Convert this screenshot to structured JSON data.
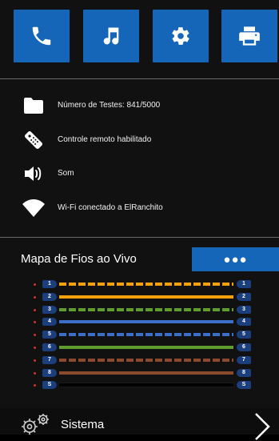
{
  "toolbar": {
    "buttons": [
      {
        "icon": "phone-icon",
        "label": "Telefone"
      },
      {
        "icon": "music-note-icon",
        "label": "Música"
      },
      {
        "icon": "gear-icon",
        "label": "Configurações"
      },
      {
        "icon": "printer-icon",
        "label": "Imprimir"
      }
    ],
    "button_color": "#1565b8"
  },
  "status": {
    "items": [
      {
        "icon": "folder-icon",
        "text": "Número de Testes: 841/5000"
      },
      {
        "icon": "remote-control-icon",
        "text": "Controle remoto habilitado"
      },
      {
        "icon": "speaker-icon",
        "text": "Som"
      },
      {
        "icon": "wifi-icon",
        "text": "Wi-Fi conectado a ElRanchito"
      }
    ]
  },
  "wire_map": {
    "title": "Mapa de Fios ao Vivo",
    "menu_button_label": "●●●",
    "wires": [
      {
        "left_pin": "1",
        "right_pin": "1",
        "color": "#f5a10a",
        "pattern": "striped"
      },
      {
        "left_pin": "2",
        "right_pin": "2",
        "color": "#f5a10a",
        "pattern": "solid"
      },
      {
        "left_pin": "3",
        "right_pin": "3",
        "color": "#5f9e2e",
        "pattern": "striped"
      },
      {
        "left_pin": "4",
        "right_pin": "4",
        "color": "#3b6fc9",
        "pattern": "solid"
      },
      {
        "left_pin": "5",
        "right_pin": "5",
        "color": "#3b6fc9",
        "pattern": "striped"
      },
      {
        "left_pin": "6",
        "right_pin": "6",
        "color": "#5f9e2e",
        "pattern": "solid"
      },
      {
        "left_pin": "7",
        "right_pin": "7",
        "color": "#8a4a2b",
        "pattern": "striped"
      },
      {
        "left_pin": "8",
        "right_pin": "8",
        "color": "#8a4a2b",
        "pattern": "solid"
      },
      {
        "left_pin": "S",
        "right_pin": "S",
        "color": "#000000",
        "pattern": "solid"
      }
    ]
  },
  "bottom": {
    "label": "Sistema",
    "icon": "gears-icon",
    "chevron": "chevron-right-icon"
  }
}
